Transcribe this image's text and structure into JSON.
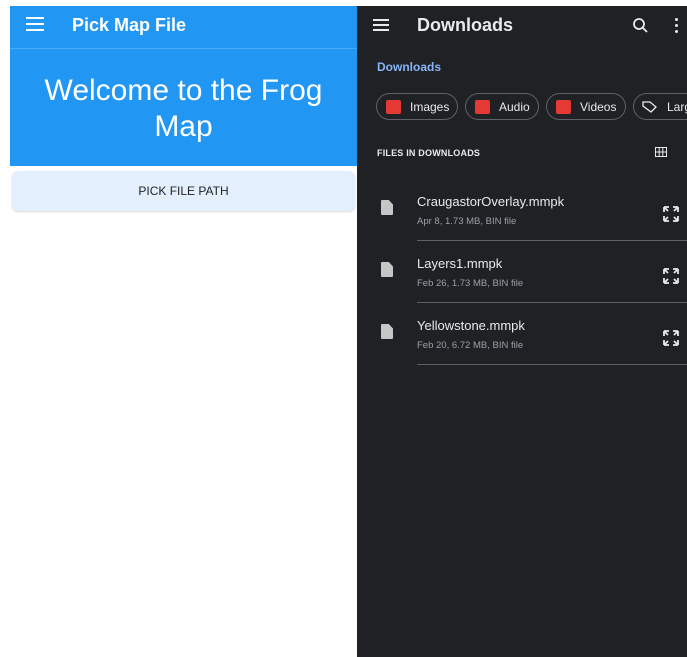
{
  "left": {
    "appbar": {
      "title": "Pick Map File",
      "color": "#2196f3"
    },
    "hero": {
      "heading_line1": "Welcome to the Frog",
      "heading_line2": "Map"
    },
    "pick_button_label": "PICK FILE PATH"
  },
  "right": {
    "toolbar": {
      "title": "Downloads",
      "icons": [
        "menu-icon",
        "search-icon",
        "more-vert-icon"
      ]
    },
    "breadcrumb": "Downloads",
    "chips": [
      {
        "label": "Images",
        "icon": "image-icon"
      },
      {
        "label": "Audio",
        "icon": "headphones-icon"
      },
      {
        "label": "Videos",
        "icon": "movie-icon"
      },
      {
        "label": "Larg",
        "icon": "tag-icon"
      }
    ],
    "section_header": "FILES IN DOWNLOADS",
    "files": [
      {
        "name": "CraugastorOverlay.mmpk",
        "meta": "Apr 8, 1.73 MB, BIN file"
      },
      {
        "name": "Layers1.mmpk",
        "meta": "Feb 26, 1.73 MB, BIN file"
      },
      {
        "name": "Yellowstone.mmpk",
        "meta": "Feb 20, 6.72 MB, BIN file"
      }
    ],
    "colors": {
      "background": "#202124",
      "accent": "#8ab4f8",
      "chip_icon": "#e53935"
    }
  }
}
